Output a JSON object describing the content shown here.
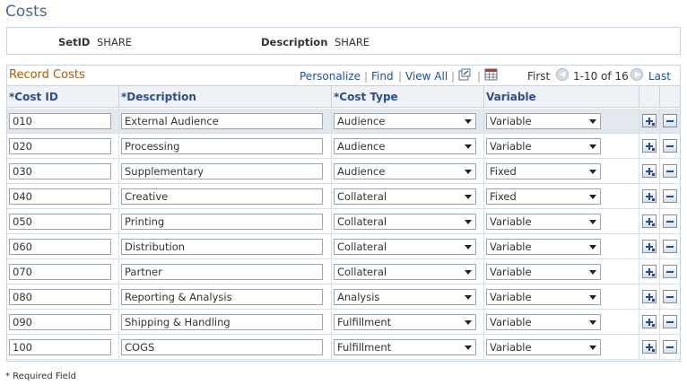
{
  "page": {
    "title": "Costs"
  },
  "keys": {
    "setid_label": "SetID",
    "setid_value": "SHARE",
    "description_label": "Description",
    "description_value": "SHARE"
  },
  "grid": {
    "title": "Record Costs",
    "personalize": "Personalize",
    "find": "Find",
    "view_all": "View All",
    "first": "First",
    "range": "1-10 of 16",
    "last": "Last",
    "columns": {
      "cost_id": "*Cost ID",
      "description": "*Description",
      "cost_type": "*Cost Type",
      "variable": "Variable"
    },
    "rows": [
      {
        "cost_id": "010",
        "description": "External Audience",
        "cost_type": "Audience",
        "variable": "Variable"
      },
      {
        "cost_id": "020",
        "description": "Processing",
        "cost_type": "Audience",
        "variable": "Variable"
      },
      {
        "cost_id": "030",
        "description": "Supplementary",
        "cost_type": "Audience",
        "variable": "Fixed"
      },
      {
        "cost_id": "040",
        "description": "Creative",
        "cost_type": "Collateral",
        "variable": "Fixed"
      },
      {
        "cost_id": "050",
        "description": "Printing",
        "cost_type": "Collateral",
        "variable": "Variable"
      },
      {
        "cost_id": "060",
        "description": "Distribution",
        "cost_type": "Collateral",
        "variable": "Variable"
      },
      {
        "cost_id": "070",
        "description": "Partner",
        "cost_type": "Collateral",
        "variable": "Variable"
      },
      {
        "cost_id": "080",
        "description": "Reporting & Analysis",
        "cost_type": "Analysis",
        "variable": "Variable"
      },
      {
        "cost_id": "090",
        "description": "Shipping & Handling",
        "cost_type": "Fulfillment",
        "variable": "Variable"
      },
      {
        "cost_id": "100",
        "description": "COGS",
        "cost_type": "Fulfillment",
        "variable": "Variable"
      }
    ]
  },
  "footnote": "* Required Field",
  "colors": {
    "title": "#4a6a9c",
    "grid_title": "#b35a00",
    "link": "#1f4e9c",
    "header_bg": "#eef2f7"
  }
}
